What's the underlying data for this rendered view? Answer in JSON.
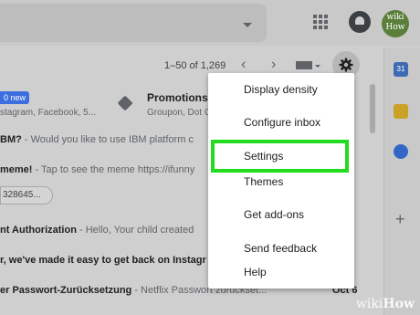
{
  "header": {
    "avatar_text": "wiki How"
  },
  "toolbar": {
    "pager_text": "1–50 of 1,269",
    "prev_glyph": "‹",
    "next_glyph": "›"
  },
  "inbox": {
    "new_badge": "0 new",
    "social_snippet": "stagram, Facebook, 5...",
    "promotions_label": "Promotions",
    "promotions_snippet": "Groupon, Dot Com",
    "rows": [
      {
        "sender": "BM?",
        "snippet": " - Would you like to use IBM platform c"
      },
      {
        "sender": "meme!",
        "snippet": " - Tap to see the meme https://ifunny"
      },
      {
        "sender": "nt Authorization",
        "snippet": " - Hello, Your child created"
      },
      {
        "sender": "r, we've made it easy to get back on Instagr",
        "snippet": ""
      },
      {
        "sender": "er Passwort-Zurücksetzung",
        "snippet": " - Netflix Passwort zurückset..."
      }
    ],
    "chip_text": "328645...",
    "last_date": "Oct 6"
  },
  "menu": {
    "items": [
      "Display density",
      "Configure inbox",
      "Settings",
      "Themes",
      "Get add-ons",
      "Send feedback",
      "Help"
    ]
  },
  "side_panel": {
    "calendar_day": "31",
    "add_glyph": "+"
  },
  "watermark": {
    "wiki": "wiki",
    "how": "How"
  },
  "colors": {
    "highlight": "#22dd1e",
    "badge_blue": "#3d6ee0"
  }
}
